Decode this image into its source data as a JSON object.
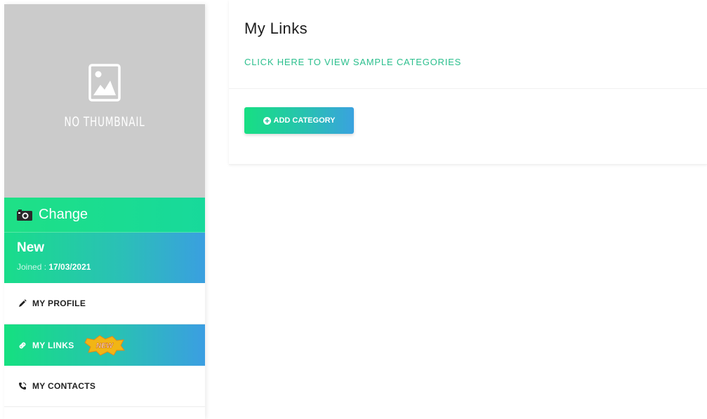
{
  "sidebar": {
    "thumbnail_label": "NO THUMBNAIL",
    "change_label": "Change",
    "user": {
      "name": "New",
      "joined_label": "Joined : ",
      "joined_date": "17/03/2021"
    },
    "nav": [
      {
        "label": "MY PROFILE",
        "icon": "pencil-icon",
        "active": false
      },
      {
        "label": "MY LINKS",
        "icon": "link-icon",
        "active": true,
        "badge": "NEW"
      },
      {
        "label": "MY CONTACTS",
        "icon": "phone-icon",
        "active": false
      }
    ]
  },
  "main": {
    "title": "My Links",
    "sample_link": "CLICK HERE TO VIEW SAMPLE CATEGORIES",
    "add_button": "ADD CATEGORY"
  },
  "colors": {
    "accent_green": "#1ee086",
    "accent_blue": "#3a9fe0",
    "link_green": "#2bbf8d",
    "thumb_gray": "#cbcbcb"
  }
}
